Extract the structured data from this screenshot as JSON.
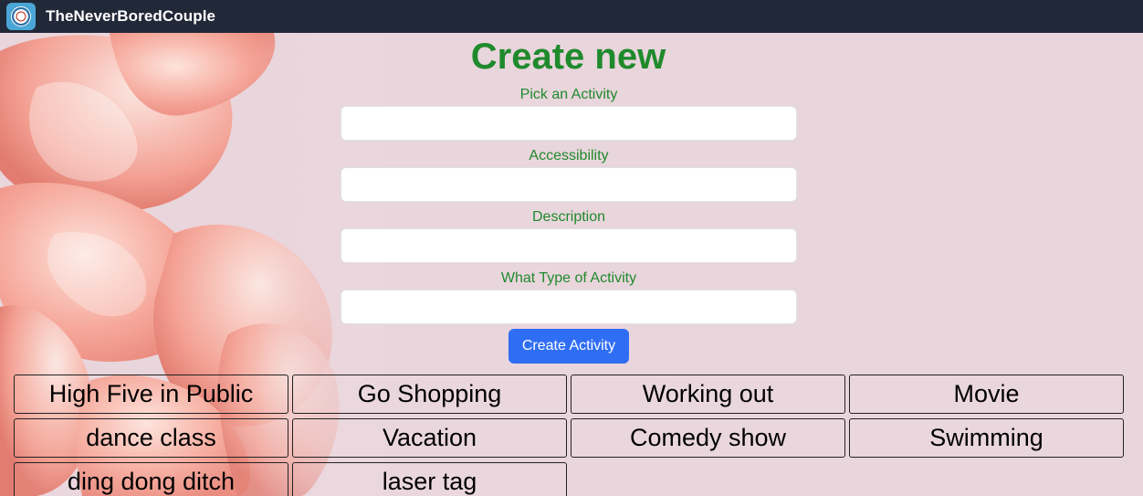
{
  "navbar": {
    "brand": "TheNeverBoredCouple",
    "logo_icon": "couple-logo-icon"
  },
  "form": {
    "title": "Create new",
    "fields": [
      {
        "label": "Pick an Activity",
        "value": "",
        "placeholder": ""
      },
      {
        "label": "Accessibility",
        "value": "",
        "placeholder": ""
      },
      {
        "label": "Description",
        "value": "",
        "placeholder": ""
      },
      {
        "label": "What Type of Activity",
        "value": "",
        "placeholder": ""
      }
    ],
    "submit_label": "Create Activity"
  },
  "activities": [
    "High Five in Public",
    "Go Shopping",
    "Working out",
    "Movie",
    "dance class",
    "Vacation",
    "Comedy show",
    "Swimming",
    "ding dong ditch",
    "laser tag"
  ],
  "colors": {
    "navbar": "#212838",
    "title_green": "#1f8a2c",
    "button_blue": "#2f6ef4",
    "background_pink": "#ead6dd",
    "petal": "#f29a8f"
  }
}
